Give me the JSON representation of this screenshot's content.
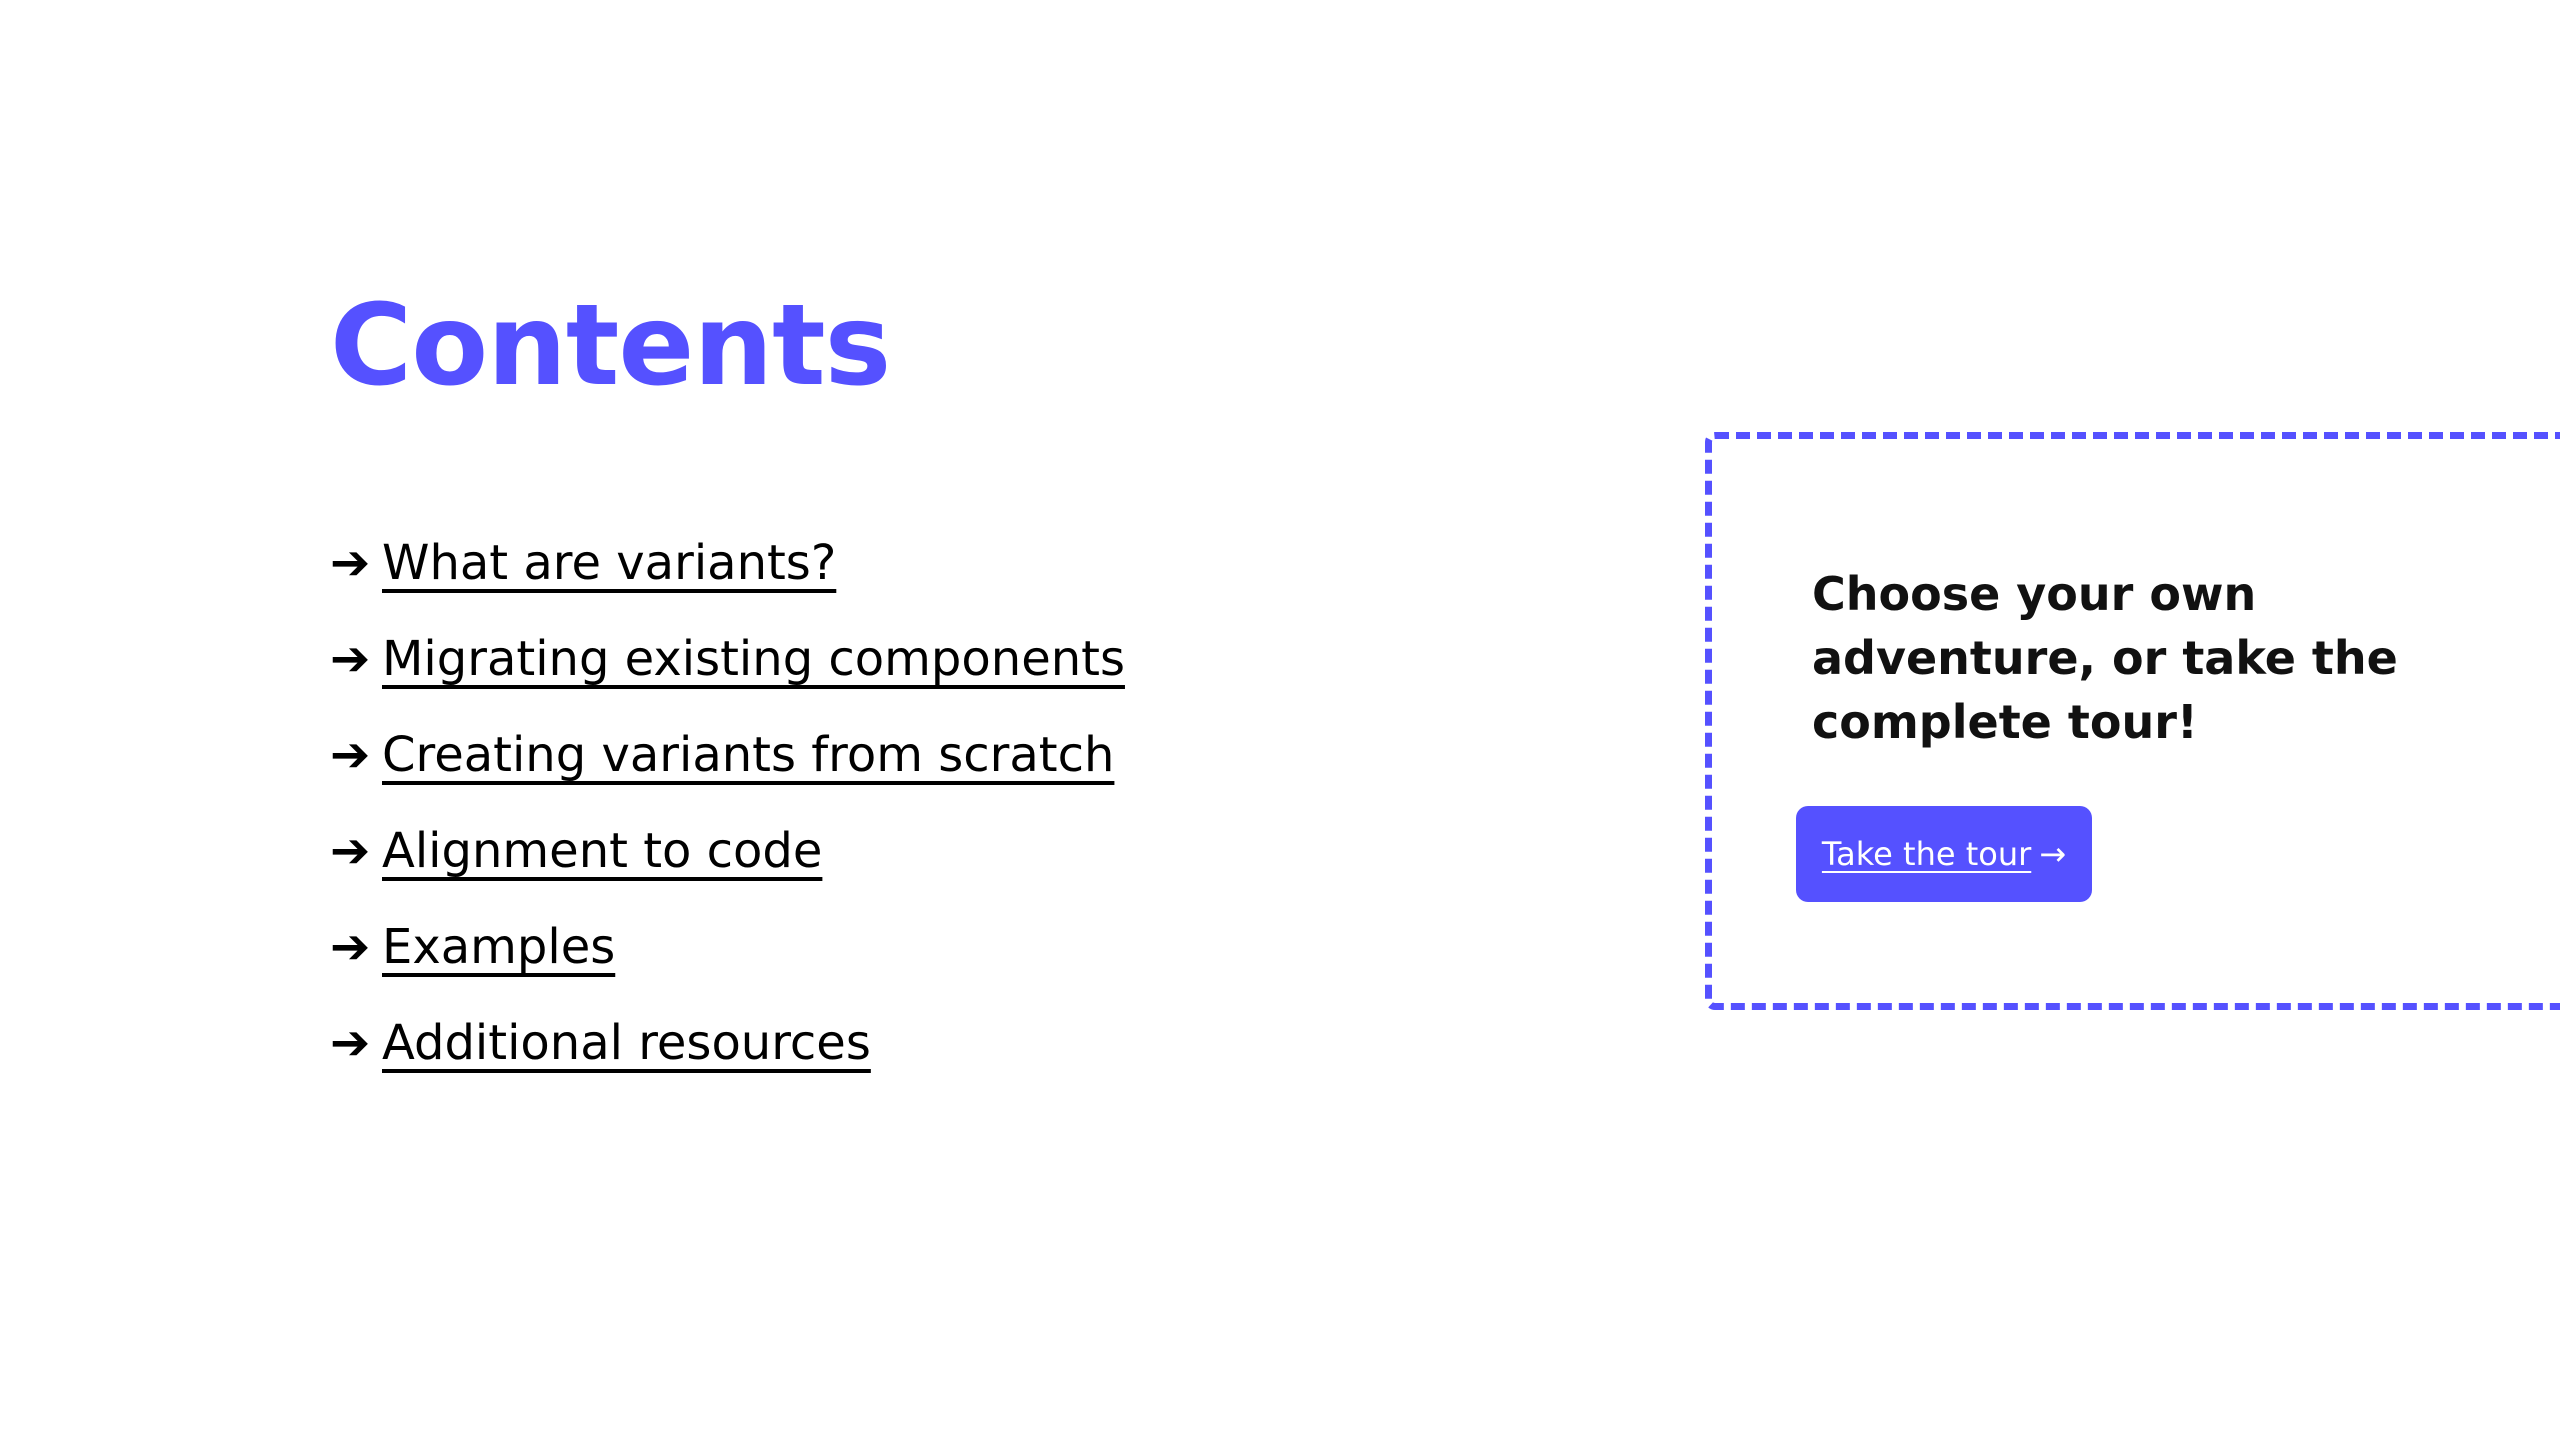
{
  "page": {
    "title": "Contents",
    "accent_color": "#5551ff"
  },
  "toc": {
    "arrow_glyph": "➔",
    "items": [
      {
        "label": "What are variants?"
      },
      {
        "label": "Migrating existing components"
      },
      {
        "label": "Creating variants from scratch"
      },
      {
        "label": "Alignment to code"
      },
      {
        "label": "Examples"
      },
      {
        "label": "Additional resources"
      }
    ]
  },
  "adventure": {
    "text": "Choose your own adventure, or take the complete tour!",
    "button_label": "Take the tour",
    "button_arrow": "→",
    "button_color": "#5551ff"
  }
}
